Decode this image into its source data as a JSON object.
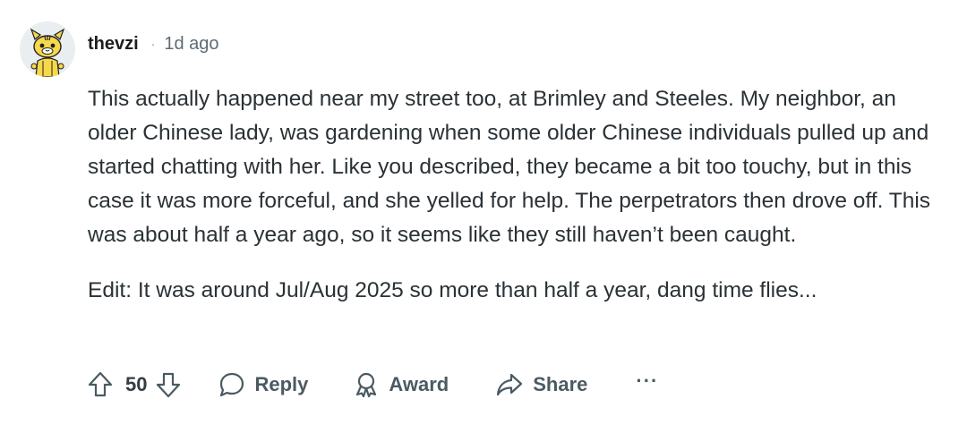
{
  "comment": {
    "username": "thevzi",
    "separator": "·",
    "time_ago": "1d ago",
    "avatar": "snoo-avatar-icon",
    "paragraphs": [
      "This actually happened near my street too, at Brimley and Steeles. My neighbor, an older Chinese lady, was gardening when some older Chinese individuals pulled up and started chatting with her. Like you described, they became a bit too touchy, but in this case it was more forceful, and she yelled for help. The perpetrators then drove off. This was about half a year ago, so it seems like they still haven’t been caught.",
      "Edit: It was around Jul/Aug 2025 so more than half a year, dang time flies..."
    ]
  },
  "actions": {
    "upvote_icon": "upvote-arrow-icon",
    "score": "50",
    "downvote_icon": "downvote-arrow-icon",
    "reply_label": "Reply",
    "reply_icon": "speech-bubble-icon",
    "award_label": "Award",
    "award_icon": "award-medal-icon",
    "share_label": "Share",
    "share_icon": "share-arrow-icon",
    "more_label": "···"
  },
  "colors": {
    "text": "#2a3236",
    "muted": "#5c6c74",
    "icon": "#4a5a62",
    "avatar_bg": "#e9eef0",
    "avatar_yellow": "#f6d84a"
  }
}
